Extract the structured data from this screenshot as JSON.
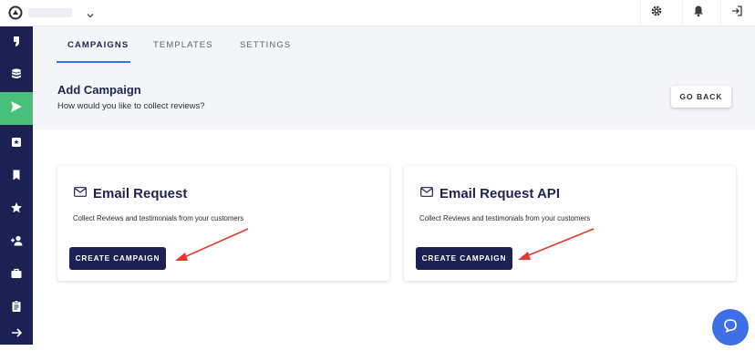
{
  "tabs": [
    {
      "label": "CAMPAIGNS",
      "active": true
    },
    {
      "label": "TEMPLATES",
      "active": false
    },
    {
      "label": "SETTINGS",
      "active": false
    }
  ],
  "header": {
    "title": "Add Campaign",
    "subtitle": "How would you like to collect reviews?",
    "go_back_label": "GO BACK"
  },
  "cards": [
    {
      "title": "Email Request",
      "description": "Collect Reviews and testimonials from your customers",
      "button_label": "CREATE CAMPAIGN",
      "icon": "mail-icon"
    },
    {
      "title": "Email Request API",
      "description": "Collect Reviews and testimonials from your customers",
      "button_label": "CREATE CAMPAIGN",
      "icon": "mail-icon"
    }
  ],
  "topbar": {
    "icons": [
      "settings-icon",
      "bell-icon",
      "logout-icon"
    ]
  },
  "sidebar": {
    "icons": [
      "quote-icon",
      "database-icon",
      "send-icon",
      "star-box-icon",
      "bookmark-icon",
      "star-icon",
      "add-user-icon",
      "briefcase-icon",
      "clipboard-icon",
      "arrow-right-icon"
    ],
    "active_index": 2
  },
  "colors": {
    "navy": "#1b2153",
    "accent_green": "#49c07a",
    "tab_underline": "#3b6fe0",
    "annotation_red": "#e23b2e",
    "chat_blue": "#3f6fe6"
  }
}
